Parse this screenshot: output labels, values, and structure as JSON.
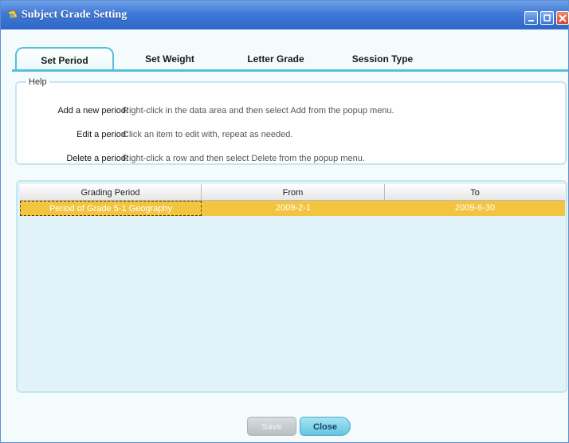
{
  "window": {
    "title": "Subject Grade Setting"
  },
  "tabs": [
    {
      "label": "Set Period",
      "active": true
    },
    {
      "label": "Set Weight",
      "active": false
    },
    {
      "label": "Letter Grade",
      "active": false
    },
    {
      "label": "Session Type",
      "active": false
    }
  ],
  "help": {
    "legend": "Help",
    "rows": [
      {
        "label": "Add a new period:",
        "text": "Right-click in the data area and then select Add from the popup menu."
      },
      {
        "label": "Edit a period:",
        "text": "Click an item to edit with, repeat as needed."
      },
      {
        "label": "Delete a period:",
        "text": "Right-click a row and then select Delete from the popup menu."
      }
    ]
  },
  "table": {
    "columns": [
      "Grading Period",
      "From",
      "To"
    ],
    "rows": [
      {
        "grading_period": "Period  of Grade 5-1 Geography",
        "from": "2009-2-1",
        "to": "2009-6-30",
        "selected": true
      }
    ]
  },
  "buttons": {
    "save": "Save",
    "close": "Close"
  },
  "colors": {
    "titlebar": "#3f78d6",
    "tab_accent": "#56bfd8",
    "selected_row": "#f2c440",
    "panel_bg": "#e2f2f9"
  }
}
